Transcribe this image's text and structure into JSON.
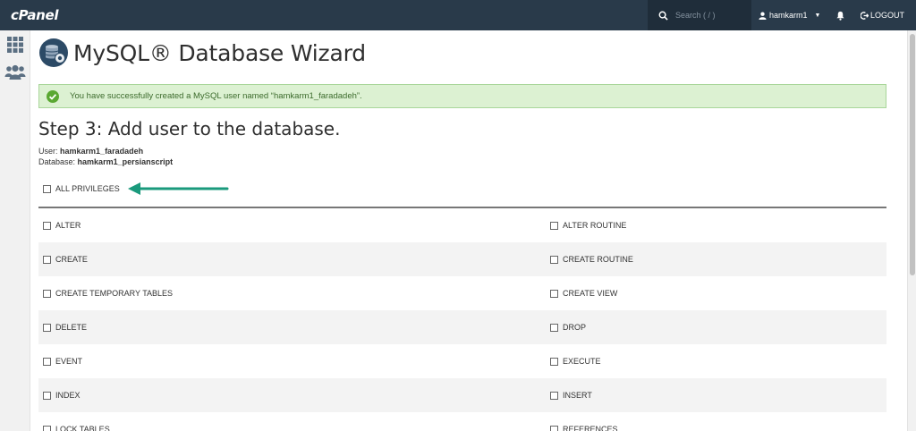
{
  "app": {
    "logo": "cPanel"
  },
  "topbar": {
    "search_placeholder": "Search ( / )",
    "username": "hamkarm1",
    "logout_label": "LOGOUT"
  },
  "page": {
    "title": "MySQL® Database Wizard",
    "alert": "You have successfully created a MySQL user named “hamkarm1_faradadeh”.",
    "step_title": "Step 3: Add user to the database.",
    "user_label": "User:",
    "user_value": "hamkarm1_faradadeh",
    "database_label": "Database:",
    "database_value": "hamkarm1_persianscript",
    "all_privileges": "ALL PRIVILEGES"
  },
  "privileges": [
    {
      "left": "ALTER",
      "right": "ALTER ROUTINE"
    },
    {
      "left": "CREATE",
      "right": "CREATE ROUTINE"
    },
    {
      "left": "CREATE TEMPORARY TABLES",
      "right": "CREATE VIEW"
    },
    {
      "left": "DELETE",
      "right": "DROP"
    },
    {
      "left": "EVENT",
      "right": "EXECUTE"
    },
    {
      "left": "INDEX",
      "right": "INSERT"
    },
    {
      "left": "LOCK TABLES",
      "right": "REFERENCES"
    }
  ],
  "colors": {
    "topbar": "#293a4a",
    "alert_bg": "#dcf1d2",
    "alert_icon": "#5aa832",
    "arrow": "#1a9a7c"
  },
  "icons": {
    "search": "search-icon",
    "user": "user-icon",
    "bell": "bell-icon",
    "logout": "logout-icon",
    "apps": "grid-icon",
    "users": "users-icon",
    "database": "database-icon",
    "success": "check-circle-icon",
    "annotation": "arrow-left-icon"
  }
}
